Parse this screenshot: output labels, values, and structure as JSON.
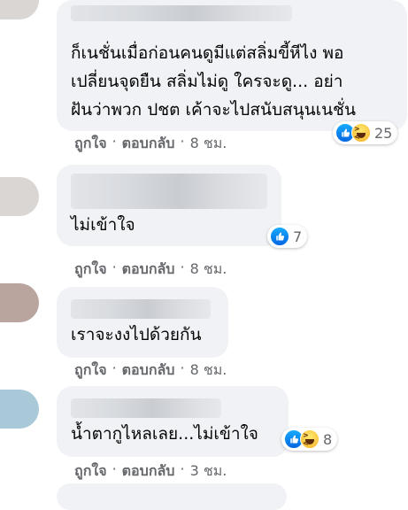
{
  "comments": [
    {
      "text": "ก็เนชั่นเมื่อก่อนคนดูมีแต่สลิ่มขี้หีไง พอ\nเปลี่ยนจุดยืน สลิ่มไม่ดู ใครจะดู... อย่า\nฝันว่าพวก ปชต เค้าจะไปสนับสนุนเนชั่น",
      "reactions": [
        "like-icon",
        "haha-icon"
      ],
      "reaction_count": "25",
      "like_label": "ถูกใจ",
      "reply_label": "ตอบกลับ",
      "time": "8 ชม."
    },
    {
      "text": "ไม่เข้าใจ",
      "reactions": [
        "like-icon"
      ],
      "reaction_count": "7",
      "like_label": "ถูกใจ",
      "reply_label": "ตอบกลับ",
      "time": "8 ชม."
    },
    {
      "text": "เราจะงงไปด้วยกัน",
      "reactions": [],
      "reaction_count": "",
      "like_label": "ถูกใจ",
      "reply_label": "ตอบกลับ",
      "time": "8 ชม."
    },
    {
      "text": "น้ำตากูไหลเลย...ไม่เข้าใจ",
      "reactions": [
        "like-icon",
        "haha-icon"
      ],
      "reaction_count": "8",
      "like_label": "ถูกใจ",
      "reply_label": "ตอบกลับ",
      "time": "3 ชม."
    }
  ],
  "separator": "·",
  "colors": {
    "bubble": "#f0f2f5",
    "meta": "#65676b",
    "like": "#0866ff"
  }
}
